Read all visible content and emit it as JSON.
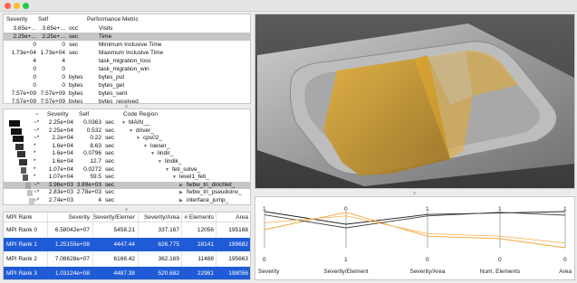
{
  "window": {
    "controls": [
      "close",
      "minimize",
      "zoom"
    ]
  },
  "metric_table": {
    "headers": {
      "severity": "Severity",
      "self": "Self",
      "metric": "Performance Metric"
    },
    "rows": [
      {
        "severity": "3.65e+...",
        "self": "3.65e+...",
        "unit": "occ",
        "metric": "Visits",
        "selected": false
      },
      {
        "severity": "2.25e+...",
        "self": "2.25e+...",
        "unit": "sec",
        "metric": "Time",
        "selected": true
      },
      {
        "severity": "0",
        "self": "0",
        "unit": "sec",
        "metric": "Minimum Inclusive Time",
        "selected": false
      },
      {
        "severity": "1.73e+04",
        "self": "1.73e+04",
        "unit": "sec",
        "metric": "Maximum Inclusive Time",
        "selected": false
      },
      {
        "severity": "4",
        "self": "4",
        "unit": "",
        "metric": "task_migration_loss",
        "selected": false
      },
      {
        "severity": "0",
        "self": "0",
        "unit": "",
        "metric": "task_migration_win",
        "selected": false
      },
      {
        "severity": "0",
        "self": "0",
        "unit": "bytes",
        "metric": "bytes_put",
        "selected": false
      },
      {
        "severity": "0",
        "self": "0",
        "unit": "bytes",
        "metric": "bytes_get",
        "selected": false
      },
      {
        "severity": "7.57e+09",
        "self": "7.57e+09",
        "unit": "bytes",
        "metric": "bytes_sent",
        "selected": false
      },
      {
        "severity": "7.57e+09",
        "self": "7.57e+09",
        "unit": "bytes",
        "metric": "bytes_received",
        "selected": false
      }
    ]
  },
  "call_tree": {
    "headers": {
      "mark": "~",
      "severity": "Severity",
      "self": "Self",
      "region": "Code Region"
    },
    "rows": [
      {
        "mark": "~*",
        "severity": "2.25e+04",
        "self": "0.0363",
        "unit": "sec",
        "expander": "▼",
        "region": "MAIN__",
        "depth": 0,
        "swatch_color": "#111111",
        "swatch_frac": 1.0,
        "selected": false
      },
      {
        "mark": "~*",
        "severity": "2.25e+04",
        "self": "0.532",
        "unit": "sec",
        "expander": "▼",
        "region": "driver_",
        "depth": 1,
        "swatch_color": "#111111",
        "swatch_frac": 1.0,
        "selected": false
      },
      {
        "mark": "~*",
        "severity": "2.2e+04",
        "self": "0.22",
        "unit": "sec",
        "expander": "▼",
        "region": "cps02_",
        "depth": 2,
        "swatch_color": "#151515",
        "swatch_frac": 0.98,
        "selected": false
      },
      {
        "mark": "*",
        "severity": "1.6e+04",
        "self": "8.63",
        "unit": "sec",
        "expander": "▼",
        "region": "loeser_",
        "depth": 3,
        "swatch_color": "#333333",
        "swatch_frac": 0.72,
        "selected": false
      },
      {
        "mark": "*",
        "severity": "1.6e+04",
        "self": "0.0796",
        "unit": "sec",
        "expander": "▼",
        "region": "lindir_",
        "depth": 4,
        "swatch_color": "#333333",
        "swatch_frac": 0.72,
        "selected": false
      },
      {
        "mark": "*",
        "severity": "1.6e+04",
        "self": "12.7",
        "unit": "sec",
        "expander": "▼",
        "region": "lindik_",
        "depth": 5,
        "swatch_color": "#333333",
        "swatch_frac": 0.72,
        "selected": false
      },
      {
        "mark": "*",
        "severity": "1.07e+04",
        "self": "0.0272",
        "unit": "sec",
        "expander": "▼",
        "region": "feti_solve_",
        "depth": 6,
        "swatch_color": "#5a5a5a",
        "swatch_frac": 0.48,
        "selected": false
      },
      {
        "mark": "*",
        "severity": "1.07e+04",
        "self": "59.5",
        "unit": "sec",
        "expander": "▼",
        "region": "level1_feti_",
        "depth": 7,
        "swatch_color": "#5a5a5a",
        "swatch_frac": 0.48,
        "selected": false
      },
      {
        "mark": "~*",
        "severity": "3.96e+03",
        "self": "3.89e+03",
        "unit": "sec",
        "expander": "▶",
        "region": "fwbw_tri_dirichlet_",
        "depth": 8,
        "swatch_color": "#a5a5a5",
        "swatch_frac": 0.3,
        "selected": true
      },
      {
        "mark": "~*",
        "severity": "2.83e+03",
        "self": "2.78e+03",
        "unit": "sec",
        "expander": "▶",
        "region": "fwbw_tri_pseudoinv_",
        "depth": 8,
        "swatch_color": "#c2c2c2",
        "swatch_frac": 0.3,
        "selected": false
      },
      {
        "mark": "~*",
        "severity": "2.74e+03",
        "self": "4",
        "unit": "sec",
        "expander": "▶",
        "region": "interface_jump_",
        "depth": 8,
        "swatch_color": "#c8c8c8",
        "swatch_frac": 0.3,
        "selected": false
      }
    ]
  },
  "rank_table": {
    "headers": [
      "MPI Rank",
      "Severity",
      "Severity/Element",
      "Severity/Area",
      "# Elements",
      "Area"
    ],
    "rows": [
      {
        "cells": [
          "MPI Rank 0",
          "6.58042e+07",
          "5458.21",
          "337.167",
          "12056",
          "195168"
        ],
        "highlighted": false
      },
      {
        "cells": [
          "MPI Rank 1",
          "1.25155e+08",
          "4447.44",
          "626.775",
          "28141",
          "199682"
        ],
        "highlighted": true
      },
      {
        "cells": [
          "MPI Rank 2",
          "7.08628e+07",
          "6168.42",
          "362.169",
          "11488",
          "195663"
        ],
        "highlighted": false
      },
      {
        "cells": [
          "MPI Rank 3",
          "1.03124e+08",
          "4487.38",
          "520.682",
          "22981",
          "198056"
        ],
        "highlighted": true
      }
    ]
  },
  "parallel_coords": {
    "axes": [
      {
        "label": "Severity",
        "top": "1",
        "bottom": "0"
      },
      {
        "label": "Severity/Element",
        "top": "0",
        "bottom": "1"
      },
      {
        "label": "Severity/Area",
        "top": "1",
        "bottom": "0"
      },
      {
        "label": "Num. Elements",
        "top": "1",
        "bottom": "0"
      },
      {
        "label": "Area",
        "top": "1",
        "bottom": "0"
      }
    ],
    "series": [
      {
        "values": [
          0.0,
          0.35,
          0.08,
          0.04,
          0.0
        ],
        "color": "#222222"
      },
      {
        "values": [
          0.5,
          0.02,
          0.68,
          0.75,
          1.0
        ],
        "color": "#f2a43a"
      },
      {
        "values": [
          0.09,
          0.45,
          0.12,
          0.02,
          0.1
        ],
        "color": "#444444"
      },
      {
        "values": [
          0.31,
          0.12,
          0.61,
          0.68,
          0.87
        ],
        "color": "#f7b860"
      }
    ]
  },
  "colors": {
    "selection_blue": "#1f5bd6",
    "selection_gray": "#c6c6c6",
    "highlight_orange": "#e8a020",
    "viz_background": "#4a4a4a"
  }
}
